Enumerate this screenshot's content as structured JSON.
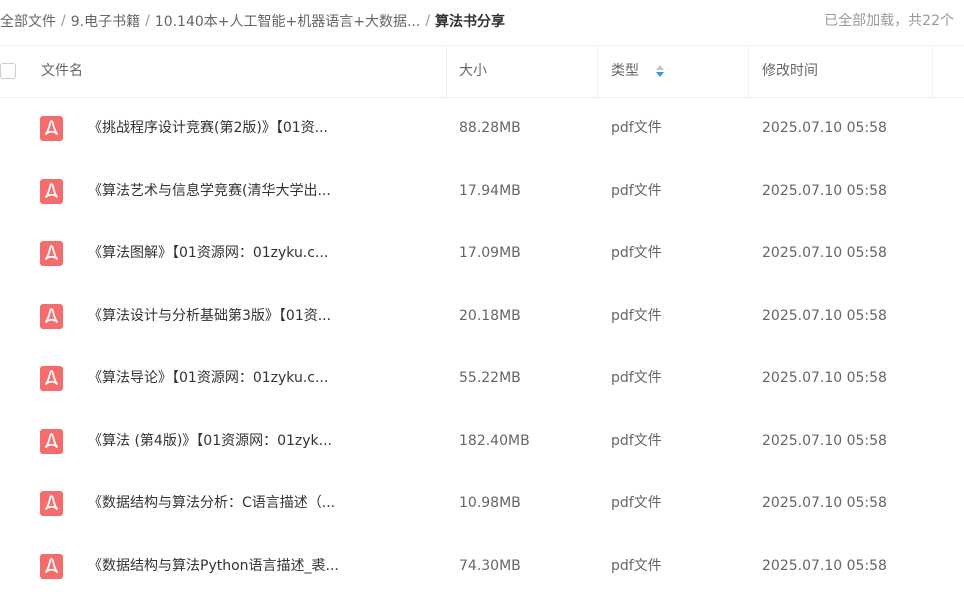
{
  "breadcrumb": [
    {
      "label": "全部文件"
    },
    {
      "label": "9.电子书籍"
    },
    {
      "label": "10.140本+人工智能+机器语言+大数据..."
    },
    {
      "label": "算法书分享"
    }
  ],
  "status_text": "已全部加载，共22个",
  "columns": {
    "name": "文件名",
    "size": "大小",
    "type": "类型",
    "modified": "修改时间"
  },
  "colors": {
    "pdf_icon": "#f56c6c",
    "sort_icon": "#2e9bf0"
  },
  "icons": {
    "file": "pdf-icon",
    "sort": "sort-icon"
  },
  "files": [
    {
      "name": "《挑战程序设计竞赛(第2版)》【01资...",
      "size": "88.28MB",
      "type": "pdf文件",
      "modified": "2025.07.10 05:58"
    },
    {
      "name": "《算法艺术与信息学竞赛(清华大学出...",
      "size": "17.94MB",
      "type": "pdf文件",
      "modified": "2025.07.10 05:58"
    },
    {
      "name": "《算法图解》【01资源网：01zyku.c...",
      "size": "17.09MB",
      "type": "pdf文件",
      "modified": "2025.07.10 05:58"
    },
    {
      "name": "《算法设计与分析基础第3版》【01资...",
      "size": "20.18MB",
      "type": "pdf文件",
      "modified": "2025.07.10 05:58"
    },
    {
      "name": "《算法导论》【01资源网：01zyku.c...",
      "size": "55.22MB",
      "type": "pdf文件",
      "modified": "2025.07.10 05:58"
    },
    {
      "name": "《算法 (第4版)》【01资源网：01zyk...",
      "size": "182.40MB",
      "type": "pdf文件",
      "modified": "2025.07.10 05:58"
    },
    {
      "name": "《数据结构与算法分析：C语言描述（...",
      "size": "10.98MB",
      "type": "pdf文件",
      "modified": "2025.07.10 05:58"
    },
    {
      "name": "《数据结构与算法Python语言描述_裘...",
      "size": "74.30MB",
      "type": "pdf文件",
      "modified": "2025.07.10 05:58"
    }
  ]
}
